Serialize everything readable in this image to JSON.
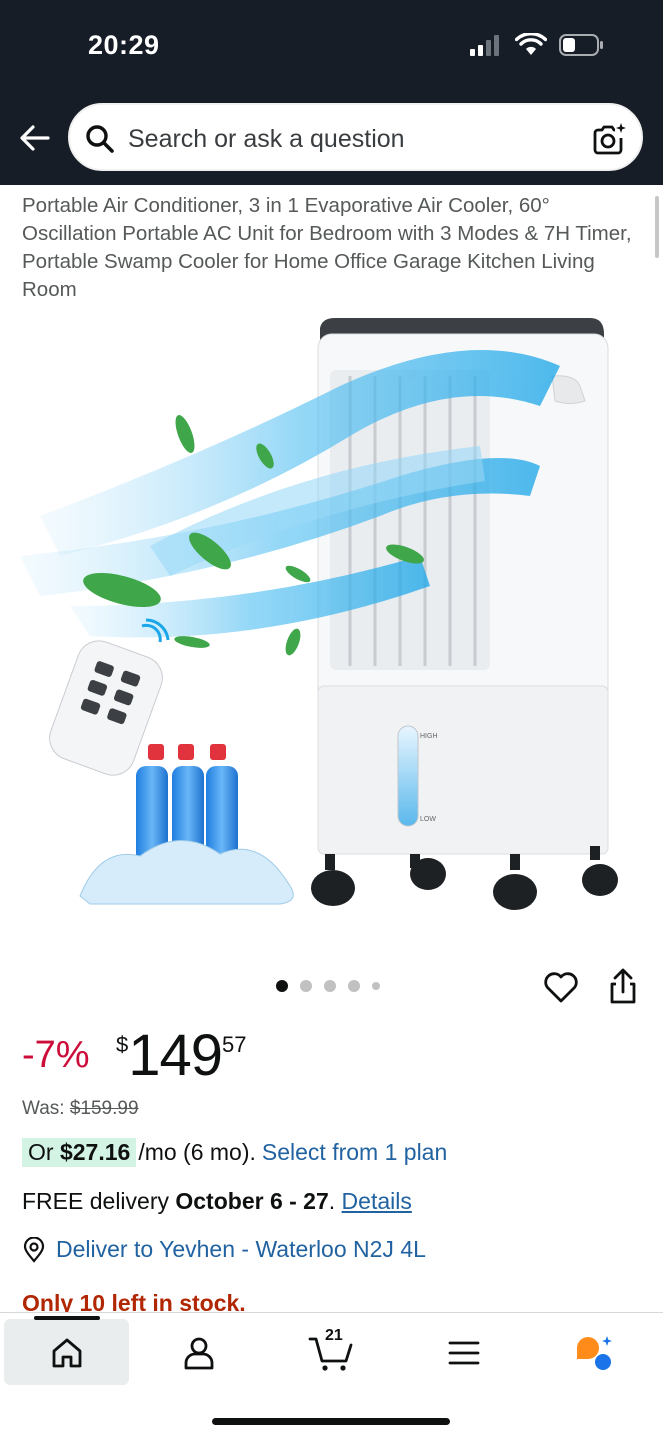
{
  "status_bar": {
    "time": "20:29",
    "icons": [
      "cellular-icon",
      "wifi-icon",
      "battery-icon"
    ]
  },
  "search": {
    "placeholder": "Search or ask a question",
    "icons": [
      "back-arrow-icon",
      "search-icon",
      "camera-search-icon"
    ]
  },
  "product": {
    "title": "Portable Air Conditioner, 3 in 1 Evaporative Air Cooler, 60° Oscillation Portable AC Unit for Bedroom with 3 Modes & 7H Timer, Portable Swamp Cooler for Home Office Garage Kitchen Living Room",
    "image_alt": "Portable evaporative air cooler with remote and ice bottles",
    "image_labels": {
      "high": "HIGH",
      "low": "LOW"
    },
    "carousel": {
      "count": 5,
      "active": 0
    }
  },
  "pricing": {
    "discount": "-7%",
    "currency_symbol": "$",
    "price_whole": "149",
    "price_fraction": "57",
    "was_label": "Was: ",
    "was_price": "$159.99",
    "plan_prefix": "Or ",
    "plan_amount": "$27.16",
    "plan_suffix": "/mo (6 mo).",
    "plan_link": "Select from 1 plan"
  },
  "delivery": {
    "prefix": "FREE delivery ",
    "dates": "October 6 - 27",
    "dot": ". ",
    "details_link": "Details",
    "deliver_to": "Deliver to Yevhen - Waterloo N2J 4L"
  },
  "stock": {
    "text": "Only 10 left in stock."
  },
  "bottom_nav": {
    "items": [
      "home-icon",
      "account-icon",
      "cart-icon",
      "menu-icon",
      "rufus-icon"
    ],
    "cart_count": "21",
    "active": "home"
  },
  "colors": {
    "header_bg": "#161d26",
    "discount_red": "#cc0c39",
    "link_blue": "#2162a1",
    "stock_red": "#b12704",
    "plan_highlight": "#d3f3e4",
    "rufus_orange": "#ff8c1a",
    "rufus_blue": "#1a73e8"
  }
}
